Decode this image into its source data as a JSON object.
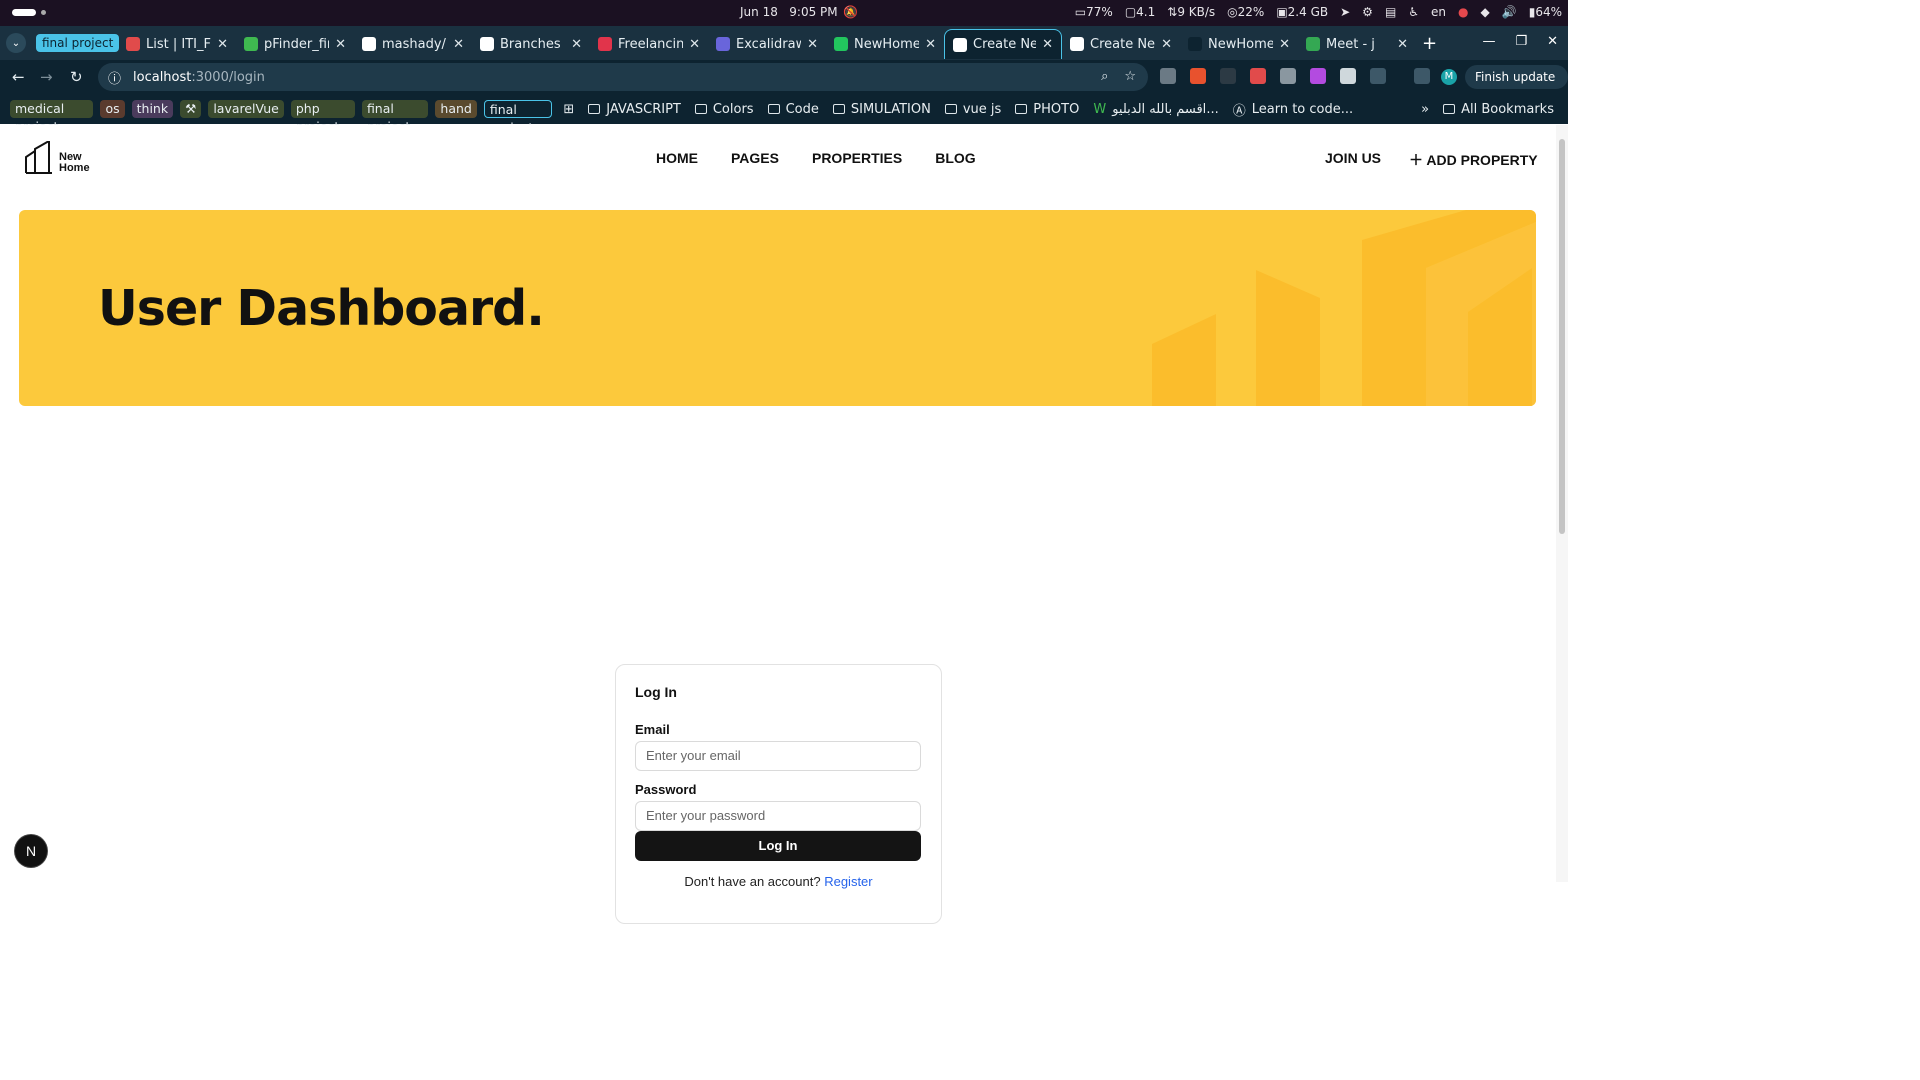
{
  "system": {
    "date": "Jun 18",
    "time": "9:05 PM",
    "indicators": [
      "77%",
      "4.1",
      "9 KB/s",
      "22%",
      "2.4 GB",
      "en",
      "64%"
    ]
  },
  "tabs": {
    "group_label": "final project",
    "items": [
      {
        "label": "List | ITI_Fi",
        "color": "#e14b4b"
      },
      {
        "label": "pFinder_fir",
        "color": "#3fb950"
      },
      {
        "label": "mashady/la",
        "color": "#ffffff"
      },
      {
        "label": "Branches",
        "color": "#ffffff"
      },
      {
        "label": "Freelancing",
        "color": "#e1344b"
      },
      {
        "label": "Excalidraw",
        "color": "#6965db"
      },
      {
        "label": "NewHome",
        "color": "#22c55e"
      },
      {
        "label": "Create Nex",
        "color": "#ffffff"
      },
      {
        "label": "Create Nex",
        "color": "#ffffff"
      },
      {
        "label": "NewHome",
        "color": "#0d2330"
      },
      {
        "label": "Meet - j",
        "color": "#34a853"
      }
    ]
  },
  "address": {
    "host": "localhost",
    "path": ":3000/login",
    "finish_update": "Finish update",
    "profile_initial": "M"
  },
  "bookmarks": {
    "chips": [
      {
        "label": "medical project",
        "bg": "#3b4b2e"
      },
      {
        "label": "os",
        "bg": "#5a3b2e"
      },
      {
        "label": "think",
        "bg": "#4a3b5c"
      },
      {
        "label": "⚒",
        "bg": "#3b4b2e"
      },
      {
        "label": "lavarelVue",
        "bg": "#3b4b2e"
      },
      {
        "label": "php project",
        "bg": "#3b4b2e"
      },
      {
        "label": "final project",
        "bg": "#3b4b2e"
      },
      {
        "label": "hand",
        "bg": "#5a4a2e"
      },
      {
        "label": "final project",
        "bg": "#0d2330"
      }
    ],
    "folders": [
      "JAVASCRIPT",
      "Colors",
      "Code",
      "SIMULATION",
      "vue js",
      "PHOTO"
    ],
    "links": [
      "اقسم بالله الدبليو...",
      "Learn to code..."
    ],
    "all_bookmarks": "All Bookmarks"
  },
  "site": {
    "logo_line1": "New",
    "logo_line2": "Home",
    "nav": [
      "HOME",
      "PAGES",
      "PROPERTIES",
      "BLOG"
    ],
    "join_us": "JOIN US",
    "add_property": "ADD PROPERTY",
    "hero_title": "User Dashboard.",
    "accent_color": "#fcc93c"
  },
  "login": {
    "title": "Log In",
    "email_label": "Email",
    "email_placeholder": "Enter your email",
    "password_label": "Password",
    "password_placeholder": "Enter your password",
    "button": "Log In",
    "register_prompt": "Don't have an account?",
    "register_link": "Register"
  },
  "dev_badge": "N"
}
